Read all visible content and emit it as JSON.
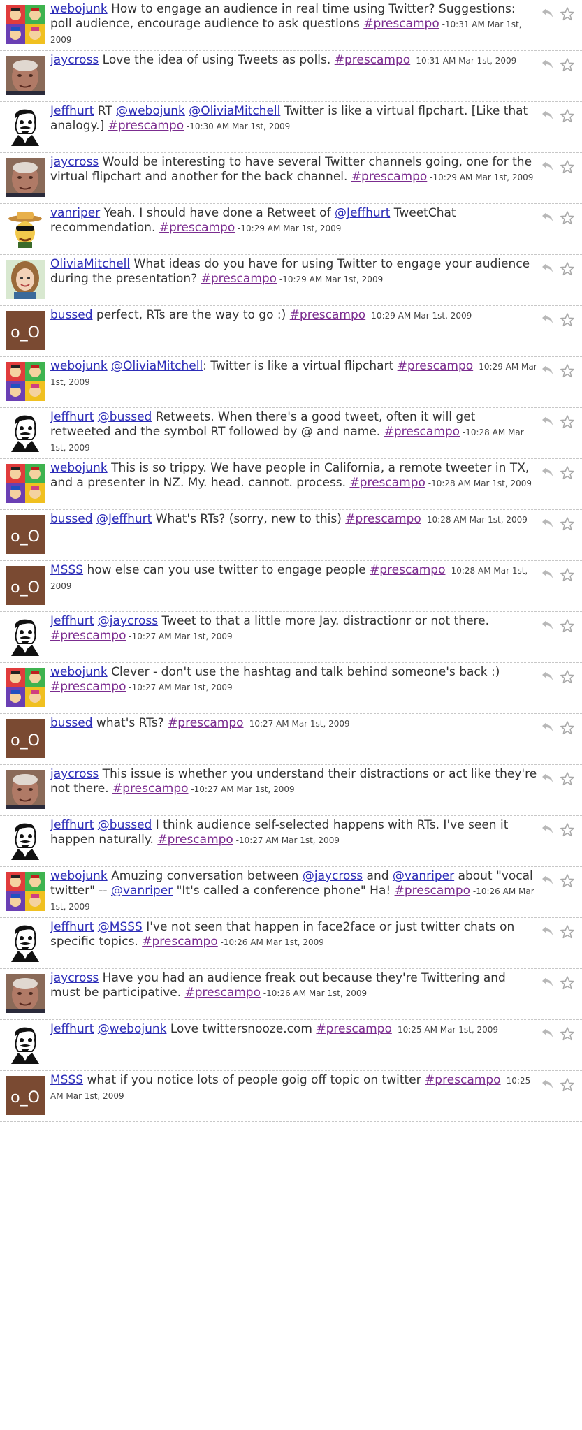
{
  "avatar_colors": {
    "webojunk": "#e03c3c",
    "jaycross": "#b07a66",
    "jeffhurt": "#ffffff",
    "vanriper": "#e8b04a",
    "oliviamitchell": "#c9a58a",
    "oo": "#7a4a32"
  },
  "avatar_label_oo": "o_O",
  "icons": {
    "reply": "reply-arrow-icon",
    "favorite": "star-icon"
  },
  "tweets": [
    {
      "avatar": "webojunk",
      "segments": [
        {
          "t": "user",
          "v": "webojunk"
        },
        {
          "t": "text",
          "v": " How to engage an audience in real time using Twitter? Suggestions: poll audience, encourage audience to ask questions "
        },
        {
          "t": "tag",
          "v": "#prescampo"
        }
      ],
      "time": " -10:31 AM Mar 1st, 2009"
    },
    {
      "avatar": "jaycross",
      "segments": [
        {
          "t": "user",
          "v": "jaycross"
        },
        {
          "t": "text",
          "v": " Love the idea of using Tweets as polls. "
        },
        {
          "t": "tag",
          "v": "#prescampo"
        }
      ],
      "time": " -10:31 AM Mar 1st, 2009"
    },
    {
      "avatar": "jeffhurt",
      "segments": [
        {
          "t": "user",
          "v": "Jeffhurt"
        },
        {
          "t": "text",
          "v": " RT "
        },
        {
          "t": "mention",
          "v": "@webojunk"
        },
        {
          "t": "text",
          "v": " "
        },
        {
          "t": "mention",
          "v": "@OliviaMitchell"
        },
        {
          "t": "text",
          "v": " Twitter is like a virtual flpchart. [Like that analogy.] "
        },
        {
          "t": "tag",
          "v": "#prescampo"
        }
      ],
      "time": " -10:30 AM Mar 1st, 2009"
    },
    {
      "avatar": "jaycross",
      "segments": [
        {
          "t": "user",
          "v": "jaycross"
        },
        {
          "t": "text",
          "v": " Would be interesting to have several Twitter channels going, one for the virtual flipchart and another for the back channel. "
        },
        {
          "t": "tag",
          "v": "#prescampo"
        }
      ],
      "time": " -10:29 AM Mar 1st, 2009"
    },
    {
      "avatar": "vanriper",
      "segments": [
        {
          "t": "user",
          "v": "vanriper"
        },
        {
          "t": "text",
          "v": " Yeah. I should have done a Retweet of "
        },
        {
          "t": "mention",
          "v": "@Jeffhurt"
        },
        {
          "t": "text",
          "v": " TweetChat recommendation. "
        },
        {
          "t": "tag",
          "v": "#prescampo"
        }
      ],
      "time": " -10:29 AM Mar 1st, 2009"
    },
    {
      "avatar": "oliviamitchell",
      "segments": [
        {
          "t": "user",
          "v": "OliviaMitchell"
        },
        {
          "t": "text",
          "v": " What ideas do you have for using Twitter to engage your audience during the presentation? "
        },
        {
          "t": "tag",
          "v": "#prescampo"
        }
      ],
      "time": " -10:29 AM Mar 1st, 2009"
    },
    {
      "avatar": "oo",
      "segments": [
        {
          "t": "user",
          "v": "bussed"
        },
        {
          "t": "text",
          "v": " perfect, RTs are the way to go :) "
        },
        {
          "t": "tag",
          "v": "#prescampo"
        }
      ],
      "time": " -10:29 AM Mar 1st, 2009"
    },
    {
      "avatar": "webojunk",
      "segments": [
        {
          "t": "user",
          "v": "webojunk"
        },
        {
          "t": "text",
          "v": " "
        },
        {
          "t": "mention",
          "v": "@OliviaMitchell"
        },
        {
          "t": "text",
          "v": ": Twitter is like a virtual flipchart "
        },
        {
          "t": "tag",
          "v": "#prescampo"
        }
      ],
      "time": " -10:29 AM Mar 1st, 2009"
    },
    {
      "avatar": "jeffhurt",
      "segments": [
        {
          "t": "user",
          "v": "Jeffhurt"
        },
        {
          "t": "text",
          "v": " "
        },
        {
          "t": "mention",
          "v": "@bussed"
        },
        {
          "t": "text",
          "v": " Retweets. When there's a good tweet, often it will get retweeted and the symbol RT followed by @ and name. "
        },
        {
          "t": "tag",
          "v": "#prescampo"
        }
      ],
      "time": " -10:28 AM Mar 1st, 2009"
    },
    {
      "avatar": "webojunk",
      "segments": [
        {
          "t": "user",
          "v": "webojunk"
        },
        {
          "t": "text",
          "v": " This is so trippy. We have people in California, a remote tweeter in TX, and a presenter in NZ. My. head. cannot. process. "
        },
        {
          "t": "tag",
          "v": "#prescampo"
        }
      ],
      "time": " -10:28 AM Mar 1st, 2009"
    },
    {
      "avatar": "oo",
      "segments": [
        {
          "t": "user",
          "v": "bussed"
        },
        {
          "t": "text",
          "v": " "
        },
        {
          "t": "mention",
          "v": "@Jeffhurt"
        },
        {
          "t": "text",
          "v": " What's RTs? (sorry, new to this) "
        },
        {
          "t": "tag",
          "v": "#prescampo"
        }
      ],
      "time": " -10:28 AM Mar 1st, 2009"
    },
    {
      "avatar": "oo",
      "segments": [
        {
          "t": "user",
          "v": "MSSS"
        },
        {
          "t": "text",
          "v": " how else can you use twitter to engage people "
        },
        {
          "t": "tag",
          "v": "#prescampo"
        }
      ],
      "time": " -10:28 AM Mar 1st, 2009"
    },
    {
      "avatar": "jeffhurt",
      "segments": [
        {
          "t": "user",
          "v": "Jeffhurt"
        },
        {
          "t": "text",
          "v": " "
        },
        {
          "t": "mention",
          "v": "@jaycross"
        },
        {
          "t": "text",
          "v": " Tweet to that a little more Jay. distractionr or not there. "
        },
        {
          "t": "tag",
          "v": "#prescampo"
        }
      ],
      "time": " -10:27 AM Mar 1st, 2009"
    },
    {
      "avatar": "webojunk",
      "segments": [
        {
          "t": "user",
          "v": "webojunk"
        },
        {
          "t": "text",
          "v": " Clever - don't use the hashtag and talk behind someone's back :) "
        },
        {
          "t": "tag",
          "v": "#prescampo"
        }
      ],
      "time": " -10:27 AM Mar 1st, 2009"
    },
    {
      "avatar": "oo",
      "segments": [
        {
          "t": "user",
          "v": "bussed"
        },
        {
          "t": "text",
          "v": " what's RTs? "
        },
        {
          "t": "tag",
          "v": "#prescampo"
        }
      ],
      "time": " -10:27 AM Mar 1st, 2009"
    },
    {
      "avatar": "jaycross",
      "segments": [
        {
          "t": "user",
          "v": "jaycross"
        },
        {
          "t": "text",
          "v": " This issue is whether you understand their distractions or act like they're not there. "
        },
        {
          "t": "tag",
          "v": "#prescampo"
        }
      ],
      "time": " -10:27 AM Mar 1st, 2009"
    },
    {
      "avatar": "jeffhurt",
      "segments": [
        {
          "t": "user",
          "v": "Jeffhurt"
        },
        {
          "t": "text",
          "v": " "
        },
        {
          "t": "mention",
          "v": "@bussed"
        },
        {
          "t": "text",
          "v": " I think audience self-selected happens with RTs. I've seen it happen naturally. "
        },
        {
          "t": "tag",
          "v": "#prescampo"
        }
      ],
      "time": " -10:27 AM Mar 1st, 2009"
    },
    {
      "avatar": "webojunk",
      "segments": [
        {
          "t": "user",
          "v": "webojunk"
        },
        {
          "t": "text",
          "v": " Amuzing conversation between "
        },
        {
          "t": "mention",
          "v": "@jaycross"
        },
        {
          "t": "text",
          "v": " and "
        },
        {
          "t": "mention",
          "v": "@vanriper"
        },
        {
          "t": "text",
          "v": " about \"vocal twitter\" -- "
        },
        {
          "t": "mention",
          "v": "@vanriper"
        },
        {
          "t": "text",
          "v": " \"It's called a conference phone\" Ha! "
        },
        {
          "t": "tag",
          "v": "#prescampo"
        }
      ],
      "time": " -10:26 AM Mar 1st, 2009"
    },
    {
      "avatar": "jeffhurt",
      "segments": [
        {
          "t": "user",
          "v": "Jeffhurt"
        },
        {
          "t": "text",
          "v": " "
        },
        {
          "t": "mention",
          "v": "@MSSS"
        },
        {
          "t": "text",
          "v": " I've not seen that happen in face2face or just twitter chats on specific topics. "
        },
        {
          "t": "tag",
          "v": "#prescampo"
        }
      ],
      "time": " -10:26 AM Mar 1st, 2009"
    },
    {
      "avatar": "jaycross",
      "segments": [
        {
          "t": "user",
          "v": "jaycross"
        },
        {
          "t": "text",
          "v": " Have you had an audience freak out because they're Twittering and must be participative. "
        },
        {
          "t": "tag",
          "v": "#prescampo"
        }
      ],
      "time": " -10:26 AM Mar 1st, 2009"
    },
    {
      "avatar": "jeffhurt",
      "segments": [
        {
          "t": "user",
          "v": "Jeffhurt"
        },
        {
          "t": "text",
          "v": " "
        },
        {
          "t": "mention",
          "v": "@webojunk"
        },
        {
          "t": "text",
          "v": " Love twittersnooze.com "
        },
        {
          "t": "tag",
          "v": "#prescampo"
        }
      ],
      "time": " -10:25 AM Mar 1st, 2009"
    },
    {
      "avatar": "oo",
      "segments": [
        {
          "t": "user",
          "v": "MSSS"
        },
        {
          "t": "text",
          "v": " what if you notice lots of people goig off topic on twitter "
        },
        {
          "t": "tag",
          "v": "#prescampo"
        }
      ],
      "time": " -10:25 AM Mar 1st, 2009"
    }
  ]
}
